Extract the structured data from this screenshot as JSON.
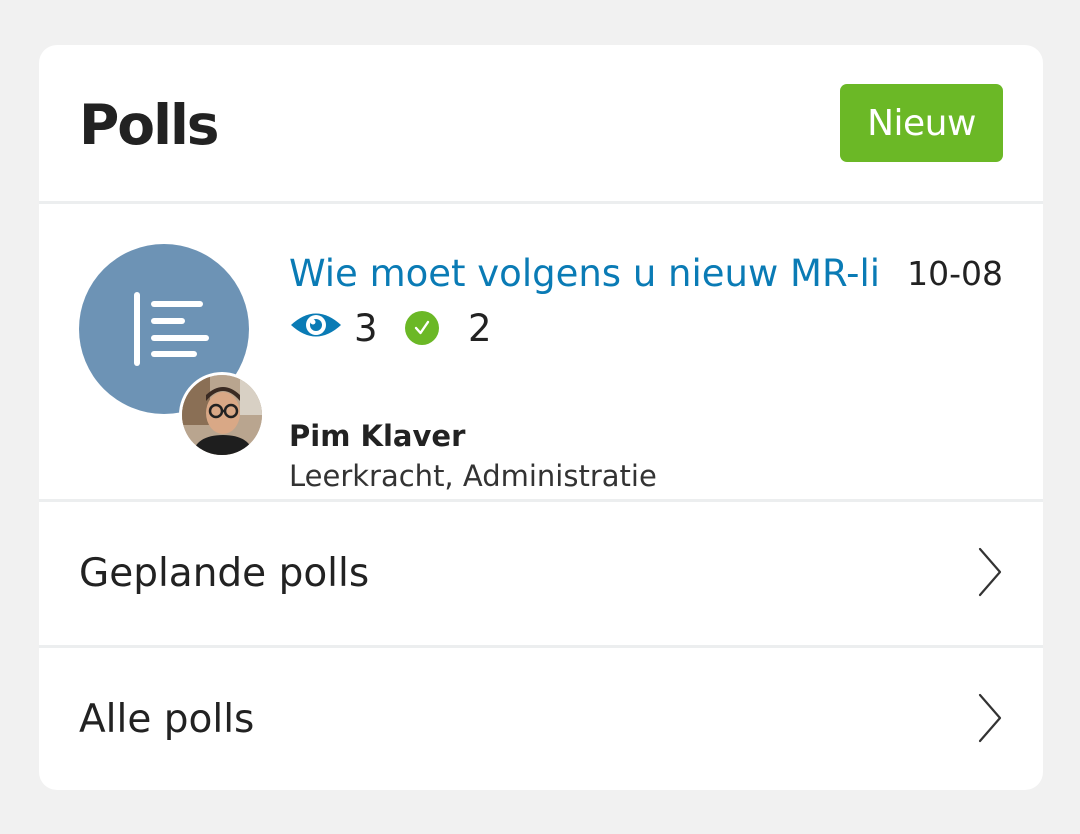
{
  "header": {
    "title": "Polls",
    "new_button_label": "Nieuw",
    "new_button_color": "#6bb826"
  },
  "poll": {
    "icon": "poll-list-icon",
    "title": "Wie moet volgens u nieuw MR-li",
    "date": "10-08",
    "views": "3",
    "answers": "2",
    "author": {
      "name": "Pim Klaver",
      "role": "Leerkracht, Administratie"
    },
    "title_color": "#0a7bb5"
  },
  "nav": [
    {
      "label": "Geplande polls",
      "icon": "chevron-right-icon"
    },
    {
      "label": "Alle polls",
      "icon": "chevron-right-icon"
    }
  ]
}
